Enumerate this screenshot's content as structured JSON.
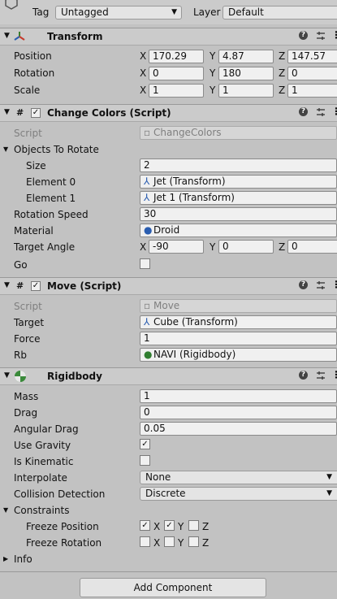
{
  "topbar": {
    "tag_label": "Tag",
    "tag_value": "Untagged",
    "layer_label": "Layer",
    "layer_value": "Default"
  },
  "transform": {
    "title": "Transform",
    "position_label": "Position",
    "rotation_label": "Rotation",
    "scale_label": "Scale",
    "position": {
      "x": "170.29",
      "y": "4.87",
      "z": "147.57"
    },
    "rotation": {
      "x": "0",
      "y": "180",
      "z": "0"
    },
    "scale": {
      "x": "1",
      "y": "1",
      "z": "1"
    }
  },
  "axes": {
    "x": "X",
    "y": "Y",
    "z": "Z"
  },
  "change_colors": {
    "title": "Change Colors (Script)",
    "script_label": "Script",
    "script_value": "ChangeColors",
    "objects_label": "Objects To Rotate",
    "size_label": "Size",
    "size_value": "2",
    "element0_label": "Element 0",
    "element0_value": "Jet (Transform)",
    "element1_label": "Element 1",
    "element1_value": "Jet 1 (Transform)",
    "rotation_speed_label": "Rotation Speed",
    "rotation_speed_value": "30",
    "material_label": "Material",
    "material_value": "Droid",
    "target_angle_label": "Target Angle",
    "target_angle": {
      "x": "-90",
      "y": "0",
      "z": "0"
    },
    "go_label": "Go",
    "go_checked": false
  },
  "move": {
    "title": "Move (Script)",
    "script_label": "Script",
    "script_value": "Move",
    "target_label": "Target",
    "target_value": "Cube (Transform)",
    "force_label": "Force",
    "force_value": "1",
    "rb_label": "Rb",
    "rb_value": "NAVI (Rigidbody)"
  },
  "rigidbody": {
    "title": "Rigidbody",
    "mass_label": "Mass",
    "mass_value": "1",
    "drag_label": "Drag",
    "drag_value": "0",
    "angular_drag_label": "Angular Drag",
    "angular_drag_value": "0.05",
    "use_gravity_label": "Use Gravity",
    "use_gravity": true,
    "is_kinematic_label": "Is Kinematic",
    "is_kinematic": false,
    "interpolate_label": "Interpolate",
    "interpolate_value": "None",
    "collision_label": "Collision Detection",
    "collision_value": "Discrete",
    "constraints_label": "Constraints",
    "freeze_position_label": "Freeze Position",
    "freeze_position": {
      "x": true,
      "y": true,
      "z": false
    },
    "freeze_rotation_label": "Freeze Rotation",
    "freeze_rotation": {
      "x": false,
      "y": false,
      "z": false
    },
    "info_label": "Info"
  },
  "icons": {
    "help": "?",
    "menu": "⋮",
    "check": "✓",
    "fold_open": "▼",
    "fold_closed": "▶",
    "dropdown": "▼",
    "script_hash": "#"
  },
  "add_component_label": "Add Component",
  "colors": {
    "background": "#c2c2c2",
    "header": "#cbcbcb",
    "field": "#f0f0f0"
  }
}
